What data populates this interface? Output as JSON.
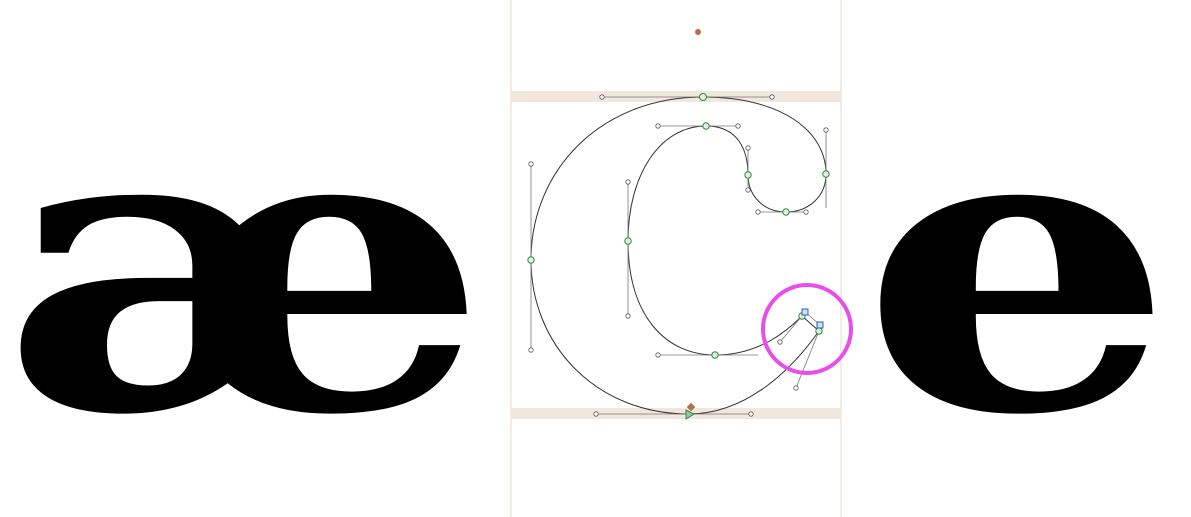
{
  "glyphs": {
    "left": "æ",
    "right": "e"
  },
  "colors": {
    "background": "#ffffff",
    "glyph_fill": "#000000",
    "metric_band": "#f0e6dc",
    "sidebearing_line": "#e8d8cc",
    "outline_stroke": "#333333",
    "node_green": "#2e8b3e",
    "handle_gray": "#888888",
    "selected_node_blue": "#2b5fb0",
    "highlight_circle": "#e84ee8",
    "anchor_brown": "#b5704a"
  },
  "icons": {
    "anchor_dot": "anchor-dot-icon",
    "start_point": "start-point-triangle-icon",
    "selection_highlight": "selection-circle-icon"
  }
}
